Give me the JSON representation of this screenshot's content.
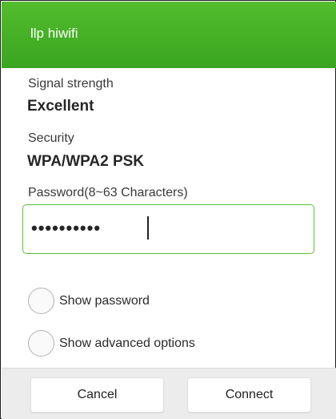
{
  "dialog": {
    "title": "llp hiwifi",
    "accent_color": "#46b125"
  },
  "signal": {
    "label": "Signal strength",
    "value": "Excellent"
  },
  "security": {
    "label": "Security",
    "value": "WPA/WPA2 PSK"
  },
  "password": {
    "label": "Password(8~63 Characters)",
    "masked_value": "••••••••••",
    "focused": true
  },
  "options": {
    "show_password": {
      "label": "Show password",
      "checked": false
    },
    "show_advanced": {
      "label": "Show advanced options",
      "checked": false
    }
  },
  "buttons": {
    "cancel": "Cancel",
    "connect": "Connect"
  }
}
